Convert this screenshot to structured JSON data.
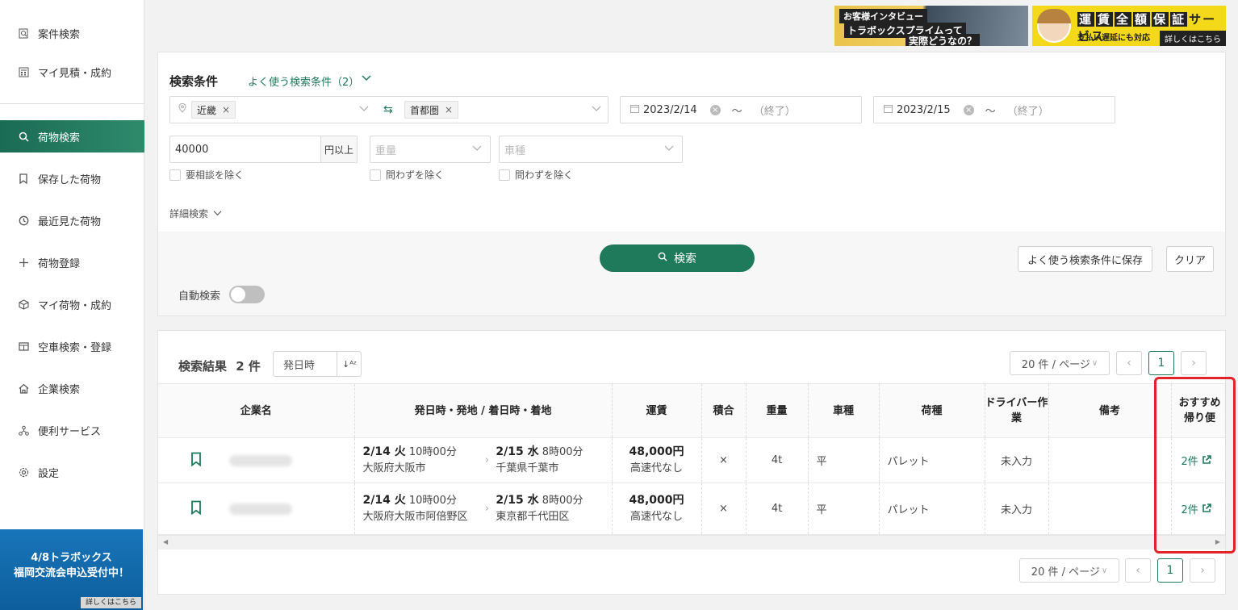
{
  "sidebar": {
    "items": [
      {
        "label": "案件検索",
        "icon": "document-search-icon"
      },
      {
        "label": "マイ見積・成約",
        "icon": "calculator-icon"
      },
      {
        "label": "荷物検索",
        "icon": "search-icon"
      },
      {
        "label": "保存した荷物",
        "icon": "bookmark-icon"
      },
      {
        "label": "最近見た荷物",
        "icon": "history-icon"
      },
      {
        "label": "荷物登録",
        "icon": "plus-icon"
      },
      {
        "label": "マイ荷物・成約",
        "icon": "box-icon"
      },
      {
        "label": "空車検索・登録",
        "icon": "truck-icon"
      },
      {
        "label": "企業検索",
        "icon": "building-icon"
      },
      {
        "label": "便利サービス",
        "icon": "network-icon"
      },
      {
        "label": "設定",
        "icon": "gear-icon"
      }
    ],
    "banner": {
      "line1": "4/8トラボックス",
      "line2": "福岡交流会申込受付中！",
      "more": "詳しくはこちら"
    }
  },
  "ads": {
    "interview": {
      "line1": "お客様インタビュー",
      "line2": "トラボックスプライムって",
      "line3": "実際どうなの？"
    },
    "guarantee": {
      "title_chars": [
        "運",
        "賃",
        "全",
        "額",
        "保",
        "証"
      ],
      "suffix": "サービス",
      "sub": "支払い遅延にも対応",
      "more": "詳しくはこちら"
    }
  },
  "search": {
    "title": "検索条件",
    "saved_link": "よく使う検索条件（2）",
    "origin_tag": "近畿",
    "dest_tag": "首都圏",
    "date1": "2023/2/14",
    "date2": "2023/2/15",
    "tilde": "～",
    "end_placeholder": "（終了）",
    "fare_value": "40000",
    "fare_unit": "円以上",
    "weight_placeholder": "重量",
    "vehicle_placeholder": "車種",
    "check1": "要相談を除く",
    "check2": "問わずを除く",
    "check3": "問わずを除く",
    "detail": "詳細検索",
    "search_button": "検索",
    "save_button": "よく使う検索条件に保存",
    "clear_button": "クリア",
    "auto_search": "自動検索"
  },
  "results": {
    "title_prefix": "検索結果",
    "count": "2",
    "count_unit": "件",
    "sort_label": "発日時",
    "page_size": "20 件 / ページ",
    "page": "1",
    "columns": [
      "企業名",
      "発日時・発地 / 着日時・着地",
      "運賃",
      "積合",
      "重量",
      "車種",
      "荷種",
      "ドライバー作業",
      "備考",
      "おすすめ帰り便"
    ],
    "rows": [
      {
        "dep_date": "2/14 火",
        "dep_time": "10時00分",
        "dep_place": "大阪府大阪市",
        "arr_date": "2/15 水",
        "arr_time": "8時00分",
        "arr_place": "千葉県千葉市",
        "fare": "48,000円",
        "fare_note": "高速代なし",
        "mixed": "×",
        "weight": "4t",
        "vehicle": "平",
        "cargo": "パレット",
        "driver": "未入力",
        "note": "",
        "recommend": "2件"
      },
      {
        "dep_date": "2/14 火",
        "dep_time": "10時00分",
        "dep_place": "大阪府大阪市阿倍野区",
        "arr_date": "2/15 水",
        "arr_time": "8時00分",
        "arr_place": "東京都千代田区",
        "fare": "48,000円",
        "fare_note": "高速代なし",
        "mixed": "×",
        "weight": "4t",
        "vehicle": "平",
        "cargo": "パレット",
        "driver": "未入力",
        "note": "",
        "recommend": "2件"
      }
    ]
  },
  "colors": {
    "accent": "#1e7a5a",
    "highlight": "#e3232c"
  }
}
